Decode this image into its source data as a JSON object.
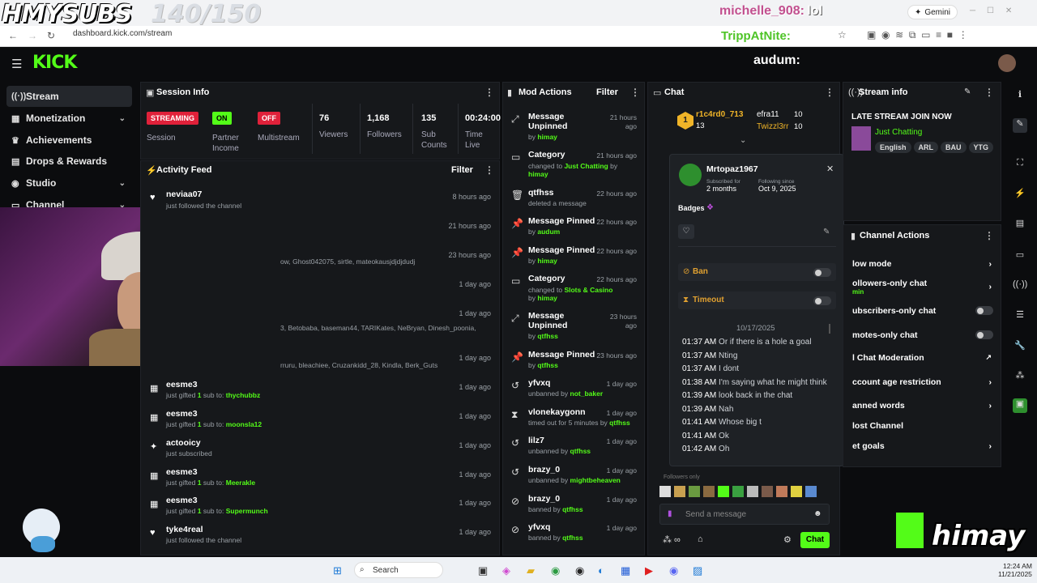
{
  "browser": {
    "url": "dashboard.kick.com/stream",
    "gemini_label": "Gemini"
  },
  "overlay": {
    "subs_label": "HMYSUBS",
    "subs_count": "140/150",
    "chat1_name": "michelle_908:",
    "chat1_msg": "lol",
    "chat2_name": "TrippAtNite:",
    "chat3_name": "audum:",
    "brand": "himay"
  },
  "sidebar": {
    "items": [
      {
        "label": "Stream"
      },
      {
        "label": "Monetization"
      },
      {
        "label": "Achievements"
      },
      {
        "label": "Drops & Rewards"
      },
      {
        "label": "Studio"
      },
      {
        "label": "Channel"
      }
    ]
  },
  "session": {
    "title": "Session Info",
    "streaming": "STREAMING",
    "session_label": "Session",
    "on": "ON",
    "partner_label": "Partner Income",
    "off": "OFF",
    "multistream_label": "Multistream",
    "viewers_value": "76",
    "viewers_label": "Viewers",
    "followers_value": "1,168",
    "followers_label": "Followers",
    "subs_value": "135",
    "subs_label": "Sub Counts",
    "time_value": "00:24:00",
    "time_label": "Time Live"
  },
  "activity": {
    "title": "Activity Feed",
    "filter": "Filter",
    "rows": [
      {
        "name": "neviaa07",
        "sub": "just followed the channel",
        "time": "8 hours ago"
      },
      {
        "name": "",
        "sub": "",
        "time": "21 hours ago"
      },
      {
        "name": "",
        "sub": "ow, Ghost042075, sirtle, mateokausjdjdjdudj",
        "time": "23 hours ago"
      },
      {
        "name": "",
        "sub": "",
        "time": "1 day ago"
      },
      {
        "name": "",
        "sub": "3, Betobaba, baseman44, TARIKates, NeBryan, Dinesh_poonia,",
        "time": "1 day ago"
      },
      {
        "name": "",
        "sub": "rruru, bleachiee, Cruzankidd_28, Kindla, Berk_Guts",
        "time": "1 day ago"
      },
      {
        "name": "eesme3",
        "sub_pre": "just gifted ",
        "num": "1",
        "sub_mid": " sub to: ",
        "target": "thychubbz",
        "time": "1 day ago"
      },
      {
        "name": "eesme3",
        "sub_pre": "just gifted ",
        "num": "1",
        "sub_mid": " sub to: ",
        "target": "moonsla12",
        "time": "1 day ago"
      },
      {
        "name": "actooicy",
        "sub": "just subscribed",
        "time": "1 day ago"
      },
      {
        "name": "eesme3",
        "sub_pre": "just gifted ",
        "num": "1",
        "sub_mid": " sub to: ",
        "target": "Meerakle",
        "time": "1 day ago"
      },
      {
        "name": "eesme3",
        "sub_pre": "just gifted ",
        "num": "1",
        "sub_mid": " sub to: ",
        "target": "Supermunch",
        "time": "1 day ago"
      },
      {
        "name": "tyke4real",
        "sub": "just followed the channel",
        "time": "1 day ago"
      }
    ]
  },
  "mod": {
    "title": "Mod Actions",
    "filter": "Filter",
    "rows": [
      {
        "title": "Message Unpinned",
        "pre": "by ",
        "link": "himay",
        "time": "21 hours ago"
      },
      {
        "title": "Category",
        "pre": "changed to ",
        "link": "Just Chatting",
        "post": " by ",
        "link2": "himay",
        "time": "21 hours ago"
      },
      {
        "title": "qtfhss",
        "pre": "deleted a message",
        "time": "22 hours ago"
      },
      {
        "title": "Message Pinned",
        "pre": "by ",
        "link": "audum",
        "time": "22 hours ago"
      },
      {
        "title": "Message Pinned",
        "pre": "by ",
        "link": "himay",
        "time": "22 hours ago"
      },
      {
        "title": "Category",
        "pre": "changed to ",
        "link": "Slots & Casino",
        "post": " by ",
        "link2": "himay",
        "time": "22 hours ago"
      },
      {
        "title": "Message Unpinned",
        "pre": "by ",
        "link": "qtfhss",
        "time": "23 hours ago"
      },
      {
        "title": "Message Pinned",
        "pre": "by ",
        "link": "qtfhss",
        "time": "23 hours ago"
      },
      {
        "title": "yfvxq",
        "pre": "unbanned by ",
        "link": "not_baker",
        "time": "1 day ago"
      },
      {
        "title": "vlonekaygonn",
        "pre": "timed out for 5 minutes by ",
        "link": "qtfhss",
        "time": "1 day ago"
      },
      {
        "title": "lilz7",
        "pre": "unbanned by ",
        "link": "qtfhss",
        "time": "1 day ago"
      },
      {
        "title": "brazy_0",
        "pre": "unbanned by ",
        "link": "mightbeheaven",
        "time": "1 day ago"
      },
      {
        "title": "brazy_0",
        "pre": "banned by ",
        "link": "qtfhss",
        "time": "1 day ago"
      },
      {
        "title": "yfvxq",
        "pre": "banned by ",
        "link": "qtfhss",
        "time": "1 day ago"
      }
    ]
  },
  "chat": {
    "title": "Chat",
    "top1_name": "r1c4rd0_713",
    "top1_count": "13",
    "top2_name": "efra11",
    "top2_count": "10",
    "top3_name": "Twizzl3rr",
    "top3_count": "10",
    "rank_badge": "1",
    "input_placeholder": "Send a message",
    "send_button": "Chat",
    "followers_only": "Followers only"
  },
  "user_card": {
    "username": "Mrtopaz1967",
    "subscribed_label": "Subscribed for",
    "subscribed_value": "2 months",
    "following_label": "Following since",
    "following_value": "Oct 9, 2025",
    "badges_label": "Badges",
    "ban_label": "Ban",
    "timeout_label": "Timeout",
    "date": "10/17/2025",
    "messages": [
      {
        "time": "01:37 AM",
        "text": "Or if there is a hole a goal"
      },
      {
        "time": "01:37 AM",
        "text": "Nting"
      },
      {
        "time": "01:37 AM",
        "text": "I dont"
      },
      {
        "time": "01:38 AM",
        "text": "I'm saying what he might think"
      },
      {
        "time": "01:39 AM",
        "text": "look back in the chat"
      },
      {
        "time": "01:39 AM",
        "text": "Nah"
      },
      {
        "time": "01:41 AM",
        "text": "Whose big t"
      },
      {
        "time": "01:41 AM",
        "text": "Ok"
      },
      {
        "time": "01:42 AM",
        "text": "Oh"
      }
    ]
  },
  "stream_info": {
    "title": "Stream info",
    "stream_title": "LATE STREAM JOIN NOW",
    "category": "Just Chatting",
    "tags": [
      "English",
      "ARL",
      "BAU",
      "YTG"
    ]
  },
  "channel_actions": {
    "title": "Channel Actions",
    "items": [
      {
        "label": "low mode"
      },
      {
        "label": "ollowers-only chat",
        "sub": "min"
      },
      {
        "label": "ubscribers-only chat"
      },
      {
        "label": "motes-only chat"
      },
      {
        "label": "l Chat Moderation"
      },
      {
        "label": "ccount age restriction"
      },
      {
        "label": "anned words"
      },
      {
        "label": "lost Channel"
      },
      {
        "label": "et goals"
      }
    ]
  },
  "taskbar": {
    "search": "Search",
    "time": "12:24 AM",
    "date": "11/21/2025"
  },
  "colors": {
    "accent": "#53fc18",
    "panel": "#16181b",
    "streaming_badge": "#e0213a"
  }
}
